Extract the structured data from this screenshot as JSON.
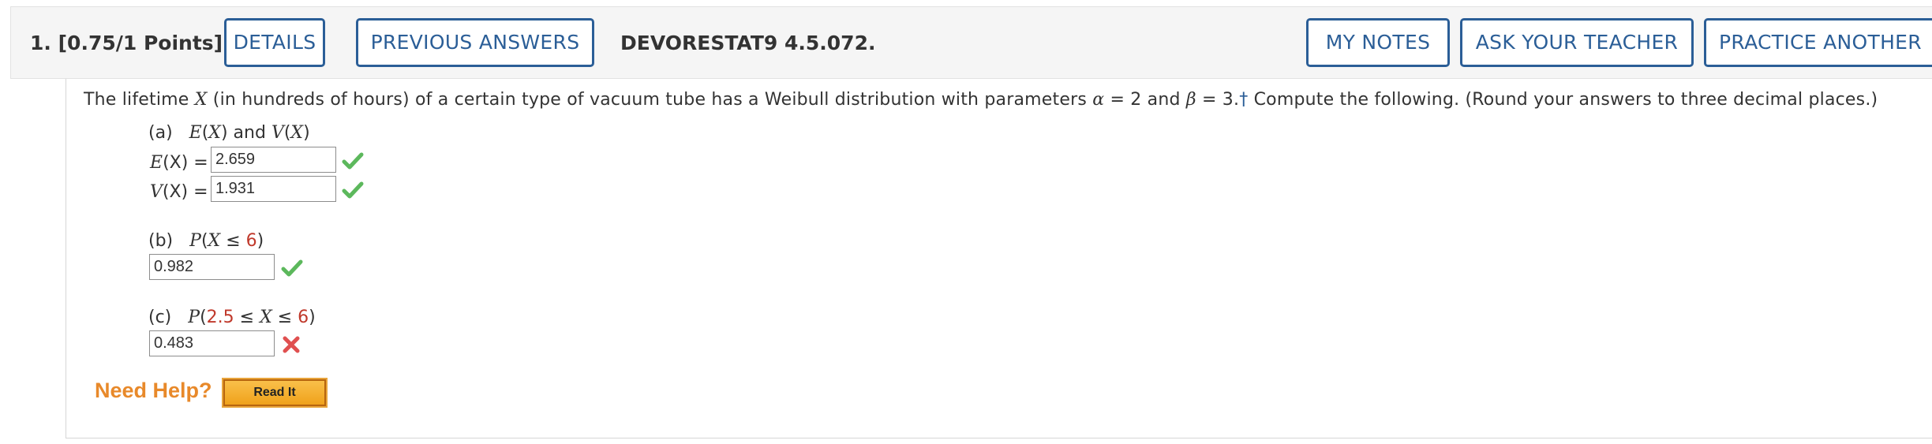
{
  "header": {
    "question_number": "1.",
    "points": "[0.75/1 Points]",
    "details_label": "DETAILS",
    "previous_answers_label": "PREVIOUS ANSWERS",
    "code": "DEVORESTAT9 4.5.072.",
    "my_notes_label": "MY NOTES",
    "ask_teacher_label": "ASK YOUR TEACHER",
    "practice_another_label": "PRACTICE ANOTHER"
  },
  "prompt": {
    "part1": "The lifetime ",
    "var": "X",
    "part2": " (in hundreds of hours) of a certain type of vacuum tube has a Weibull distribution with parameters ",
    "alpha": "α",
    "part3": " = 2 and ",
    "beta": "β",
    "part4": " = 3.",
    "dagger": "†",
    "part5": " Compute the following. (Round your answers to three decimal places.)"
  },
  "part_a": {
    "letter": "(a)",
    "title_1": "E",
    "title_2": "(",
    "title_3": "X",
    "title_4": ") and ",
    "title_5": "V",
    "title_6": "(",
    "title_7": "X",
    "title_8": ")",
    "ex_label_f": "E",
    "ex_label_rest": "(X) =",
    "ex_value": "2.659",
    "ex_status": "correct",
    "vx_label_f": "V",
    "vx_label_rest": "(X) =",
    "vx_value": "1.931",
    "vx_status": "correct"
  },
  "part_b": {
    "letter": "(b)",
    "expr_p": "P",
    "expr_open": "(",
    "expr_x": "X",
    "expr_le": " ≤ ",
    "expr_num": "6",
    "expr_close": ")",
    "value": "0.982",
    "status": "correct"
  },
  "part_c": {
    "letter": "(c)",
    "expr_p": "P",
    "expr_open": "(",
    "expr_lo": "2.5",
    "expr_le1": " ≤ ",
    "expr_x": "X",
    "expr_le2": " ≤ ",
    "expr_hi": "6",
    "expr_close": ")",
    "value": "0.483",
    "status": "incorrect"
  },
  "help": {
    "label": "Need Help?",
    "read_it_label": "Read It"
  },
  "colors": {
    "accent": "#2b5e97",
    "correct": "#5cb85c",
    "incorrect": "#e05050",
    "help": "#e8892a"
  }
}
